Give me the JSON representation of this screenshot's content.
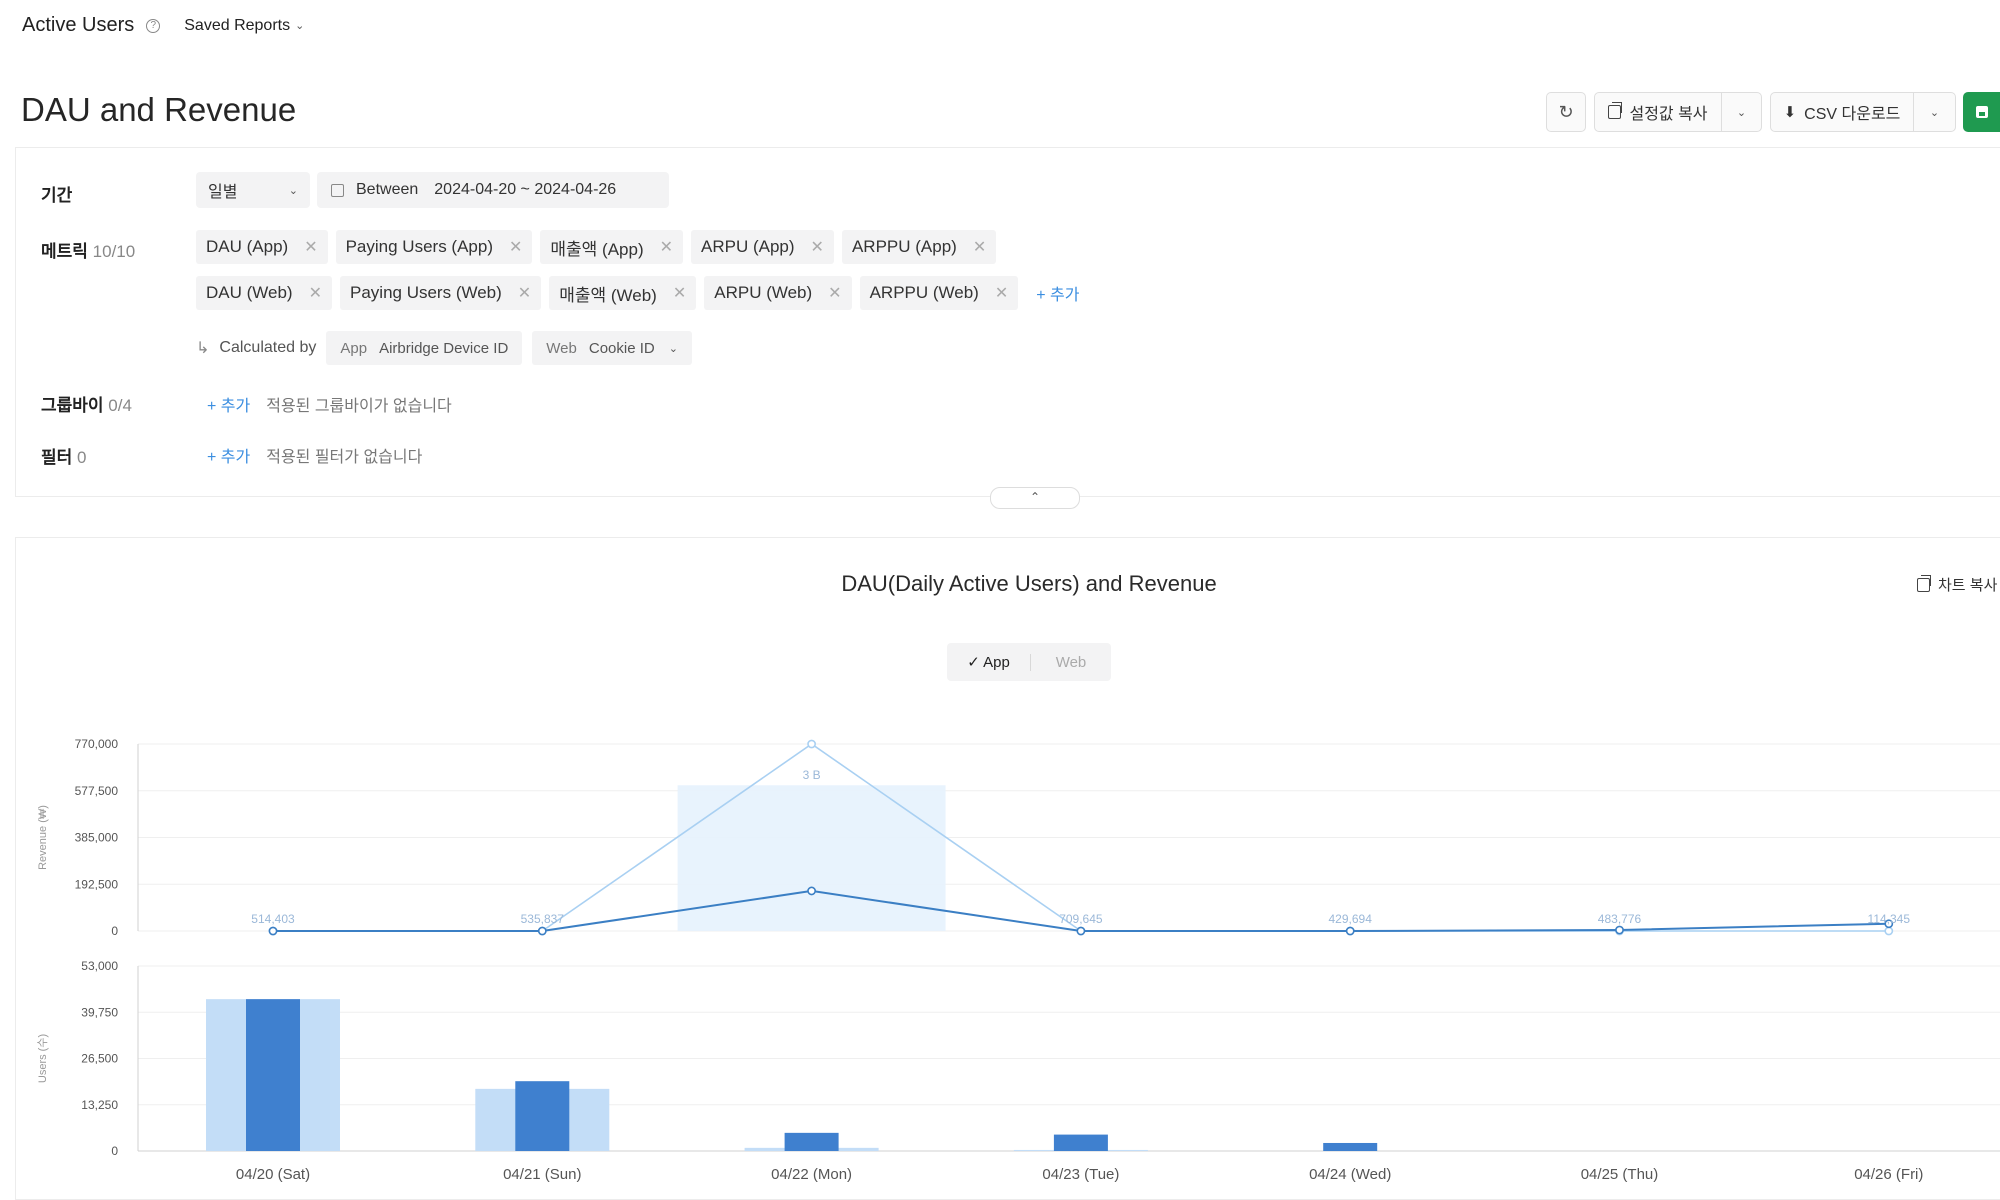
{
  "nav": {
    "title": "Active Users",
    "help_icon": "question-circle-icon",
    "saved_reports": "Saved Reports"
  },
  "page": {
    "title": "DAU and Revenue"
  },
  "toolbar": {
    "copy_settings": "설정값 복사",
    "csv_download": "CSV 다운로드",
    "save_color": "#1f9a50"
  },
  "filters": {
    "period": {
      "label": "기간",
      "granularity": "일별",
      "between_label": "Between",
      "range": "2024-04-20 ~ 2024-04-26"
    },
    "metrics": {
      "label": "메트릭",
      "count": "10/10",
      "row1": [
        "DAU (App)",
        "Paying Users (App)",
        "매출액 (App)",
        "ARPU (App)",
        "ARPPU (App)"
      ],
      "row2": [
        "DAU (Web)",
        "Paying Users (Web)",
        "매출액 (Web)",
        "ARPU (Web)",
        "ARPPU (Web)"
      ],
      "add": "+ 추가",
      "calculated_by": "Calculated by",
      "app_key": "App",
      "app_value": "Airbridge Device ID",
      "web_key": "Web",
      "web_value": "Cookie ID"
    },
    "groupby": {
      "label": "그룹바이",
      "count": "0/4",
      "add": "+ 추가",
      "empty": "적용된 그룹바이가 없습니다"
    },
    "filter": {
      "label": "필터",
      "count": "0",
      "add": "+ 추가",
      "empty": "적용된 필터가 없습니다"
    }
  },
  "chart_section": {
    "title": "DAU(Daily Active Users) and Revenue",
    "copy_chart": "차트 복사",
    "toggle": {
      "app": "App",
      "web": "Web",
      "selected": "App"
    }
  },
  "chart_data": {
    "type": "bar",
    "categories": [
      "04/20 (Sat)",
      "04/21 (Sun)",
      "04/22 (Mon)",
      "04/23 (Tue)",
      "04/24 (Wed)",
      "04/25 (Thu)",
      "04/26 (Fri)"
    ],
    "revenue_panel": {
      "ylabel": "Revenue (₩)",
      "yticks": [
        "770,000",
        "577,500",
        "385,000",
        "192,500",
        "0"
      ],
      "ylim": [
        0,
        770000
      ],
      "series": [
        {
          "type": "line",
          "values": [
            0,
            0,
            770000,
            0,
            0,
            0,
            0
          ],
          "color": "#a9d0f2"
        },
        {
          "type": "line",
          "values": [
            0,
            0,
            165000,
            0,
            0,
            4000,
            30000
          ],
          "color": "#3b7fc4"
        }
      ],
      "point_labels": [
        "514,403",
        "535,837",
        "3 B",
        "709,645",
        "429,694",
        "483,776",
        "114,345"
      ],
      "highlight": {
        "category": "04/22 (Mon)",
        "value": 600000
      }
    },
    "users_panel": {
      "ylabel": "Users (수)",
      "yticks": [
        "53,000",
        "39,750",
        "26,500",
        "13,250",
        "0"
      ],
      "ylim": [
        0,
        53000
      ],
      "series": [
        {
          "type": "bar",
          "values": [
            43500,
            17800,
            900,
            300,
            0,
            0,
            0
          ],
          "color": "#c3ddf7"
        },
        {
          "type": "bar",
          "values": [
            43500,
            20000,
            5200,
            4700,
            2300,
            0,
            0
          ],
          "color": "#3f80cf"
        }
      ]
    }
  }
}
